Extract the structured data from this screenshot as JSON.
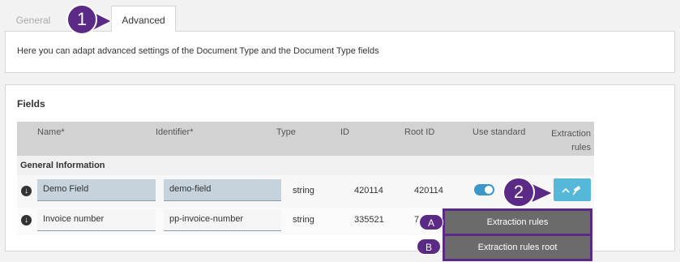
{
  "tabs": {
    "general": "General",
    "advanced": "Advanced"
  },
  "info": {
    "text": "Here you can adapt advanced settings of the Document Type and the Document Type fields"
  },
  "fields": {
    "title": "Fields",
    "columns": {
      "name": "Name*",
      "identifier": "Identifier*",
      "type": "Type",
      "id": "ID",
      "root_id": "Root ID",
      "use_standard": "Use standard",
      "extraction_rules_line1": "Extraction",
      "extraction_rules_line2": "rules"
    },
    "group": "General Information",
    "rows": [
      {
        "name": "Demo Field",
        "identifier": "demo-field",
        "type": "string",
        "id": "420114",
        "root_id": "420114",
        "use_standard": true
      },
      {
        "name": "Invoice number",
        "identifier": "pp-invoice-number",
        "type": "string",
        "id": "335521",
        "root_id": "7"
      }
    ]
  },
  "extraction_menu": {
    "button_icon": "chevron-up-gavel-icon",
    "items": [
      "Extraction rules",
      "Extraction rules root"
    ]
  },
  "callouts": {
    "one": "1",
    "two": "2",
    "a": "A",
    "b": "B"
  },
  "colors": {
    "callout": "#5b2a86",
    "toggle": "#3b97c9",
    "extract_button": "#56b8d9",
    "menu_item": "#6b6b6b"
  }
}
